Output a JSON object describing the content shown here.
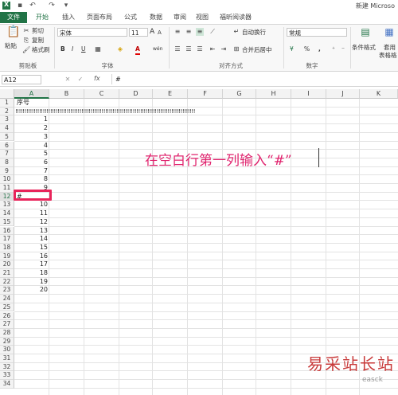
{
  "window": {
    "doc_title": "新建 Microso"
  },
  "tabs": [
    "文件",
    "开始",
    "插入",
    "页面布局",
    "公式",
    "数据",
    "审阅",
    "视图",
    "福昕阅读器"
  ],
  "ribbon": {
    "clipboard": {
      "paste": "粘贴",
      "cut": "剪切",
      "copy": "复制",
      "format_painter": "格式刷",
      "group": "剪贴板"
    },
    "font": {
      "name": "宋体",
      "size": "11",
      "bold": "B",
      "italic": "I",
      "underline": "U",
      "font_color_letter": "A",
      "size_up": "A",
      "size_down": "A",
      "wen": "wén",
      "group": "字体"
    },
    "alignment": {
      "wrap": "自动换行",
      "merge": "合并后居中",
      "group": "对齐方式"
    },
    "number": {
      "format": "常规",
      "currency": "¥",
      "percent": "%",
      "comma": ",",
      "group": "数字"
    },
    "styles": {
      "conditional": "条件格式",
      "apply": "套用",
      "table_format": "表格格"
    }
  },
  "formula_bar": {
    "cell_ref": "A12",
    "fx": "fx",
    "content": "#"
  },
  "grid": {
    "columns": [
      "A",
      "B",
      "C",
      "D",
      "E",
      "F",
      "G",
      "H",
      "I",
      "J",
      "K"
    ],
    "rows": [
      "1",
      "2",
      "3",
      "4",
      "5",
      "6",
      "7",
      "8",
      "9",
      "10",
      "11",
      "12",
      "13",
      "14",
      "15",
      "16",
      "17",
      "18",
      "19",
      "20",
      "21",
      "22",
      "23",
      "24",
      "25",
      "26",
      "27",
      "28",
      "29",
      "30",
      "31",
      "32",
      "33",
      "34"
    ],
    "header_cell": "序号",
    "row2_text": "!!!!!!!!!!!!!!!!!!!!!!!!!!!!!!!!!!!!!!!!!!!!!!!!!!!!!!!!!!!!!!!!!!!!!!!!!!!!!!!!!!!!!!!!!!!!!!!!!!",
    "values": [
      "1",
      "2",
      "3",
      "4",
      "5",
      "6",
      "7",
      "8",
      "9",
      "#",
      "10",
      "11",
      "12",
      "13",
      "14",
      "15",
      "16",
      "17",
      "18",
      "19",
      "20"
    ]
  },
  "annotation": "在空白行第一列输入“#”",
  "watermark": {
    "main": "易采站长站",
    "sub": "easck"
  },
  "colors": {
    "excel_green": "#217346",
    "highlight": "#e8245a",
    "annotation": "#e0246e"
  }
}
